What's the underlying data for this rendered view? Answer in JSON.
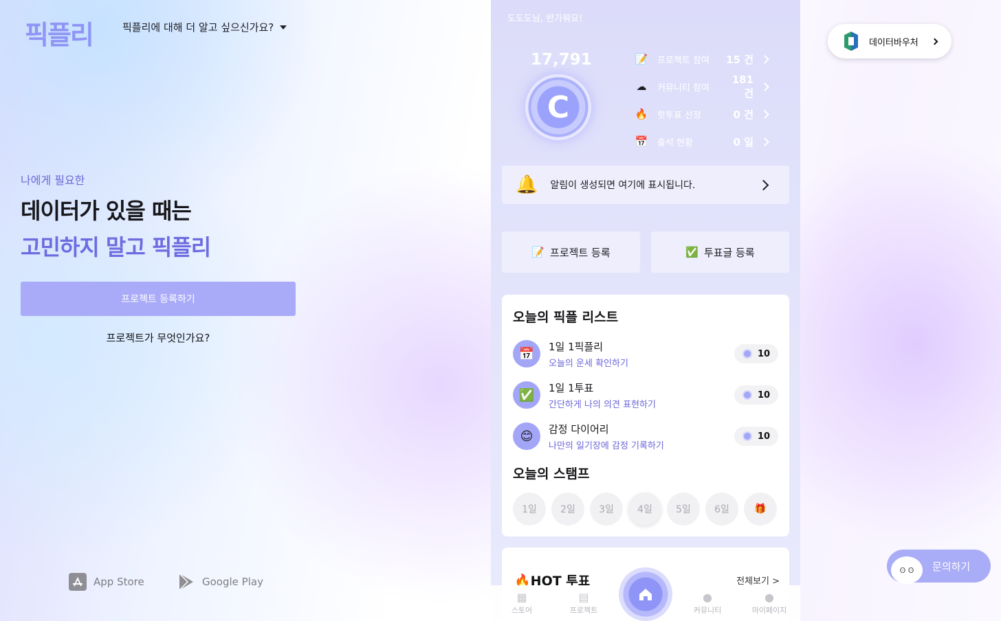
{
  "header": {
    "logo": "픽플리",
    "about_label": "픽플리에 대해 더 알고 싶으신가요?"
  },
  "hero": {
    "subtitle": "나에게 필요한",
    "line1": "데이터가 있을 때는",
    "line2": "고민하지 말고 픽플리",
    "register_button": "프로젝트 등록하기",
    "what_link": "프로젝트가 무엇인가요?"
  },
  "stores": [
    {
      "label": "App Store",
      "icon": "app-store-icon"
    },
    {
      "label": "Google Play",
      "icon": "google-play-icon"
    }
  ],
  "phone": {
    "greeting": "도도도님, 반가워요!",
    "points": "17,791",
    "coin_letter": "C",
    "stats": [
      {
        "label": "프로젝트 참여",
        "value": "15 건",
        "icon": "📝"
      },
      {
        "label": "커뮤니티 참여",
        "value": "181 건",
        "icon": "☁"
      },
      {
        "label": "핫투표 선정",
        "value": "0 건",
        "icon": "🔥"
      },
      {
        "label": "출석 현황",
        "value": "0 일",
        "icon": "📅"
      }
    ],
    "notice": "알림이 생성되면 여기에 표시됩니다.",
    "quick": {
      "project_register": "프로젝트 등록",
      "vote_register": "투표글 등록"
    },
    "today_list_title": "오늘의 픽플 리스트",
    "tasks": [
      {
        "name": "1일 1픽플리",
        "desc": "오늘의 운세 확인하기",
        "reward": "10",
        "icon": "📅"
      },
      {
        "name": "1일 1투표",
        "desc": "간단하게 나의 의견 표현하기",
        "reward": "10",
        "icon": "✅"
      },
      {
        "name": "감정 다이어리",
        "desc": "나만의 일기장에 감정 기록하기",
        "reward": "10",
        "icon": "😊"
      }
    ],
    "stamp_title": "오늘의 스탬프",
    "stamps": [
      "1일",
      "2일",
      "3일",
      "4일",
      "5일",
      "6일"
    ],
    "hot_title": "HOT 투표",
    "see_all": "전체보기 >",
    "tabs": {
      "store": "스토어",
      "project": "프로젝트",
      "community": "커뮤니티",
      "mypage": "마이페이지"
    }
  },
  "voucher": {
    "label": "데이터바우처"
  },
  "inquiry": {
    "label": "문의하기"
  }
}
